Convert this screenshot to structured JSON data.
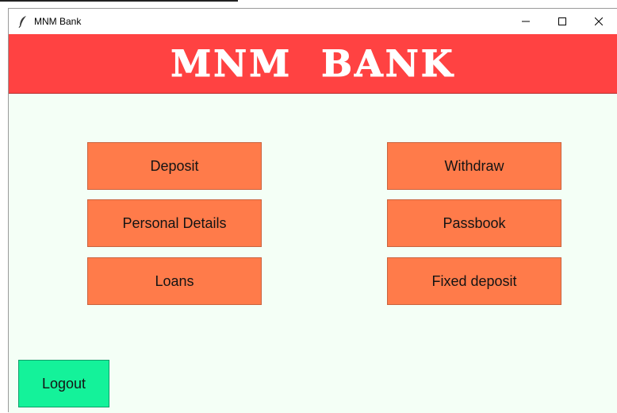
{
  "window": {
    "title": "MNM Bank",
    "controls": {
      "minimize": "—",
      "maximize": "☐",
      "close": "✕"
    }
  },
  "banner": {
    "text": "MNM BANK"
  },
  "menu": {
    "deposit": "Deposit",
    "withdraw": "Withdraw",
    "personal_details": "Personal Details",
    "passbook": "Passbook",
    "loans": "Loans",
    "fixed_deposit": "Fixed deposit"
  },
  "logout": {
    "label": "Logout"
  },
  "colors": {
    "banner": "#ff4242",
    "menu_button": "#ff7b4a",
    "logout_button": "#14f29a",
    "content_bg": "#f4fff6"
  },
  "icons": {
    "app": "feather-icon"
  }
}
